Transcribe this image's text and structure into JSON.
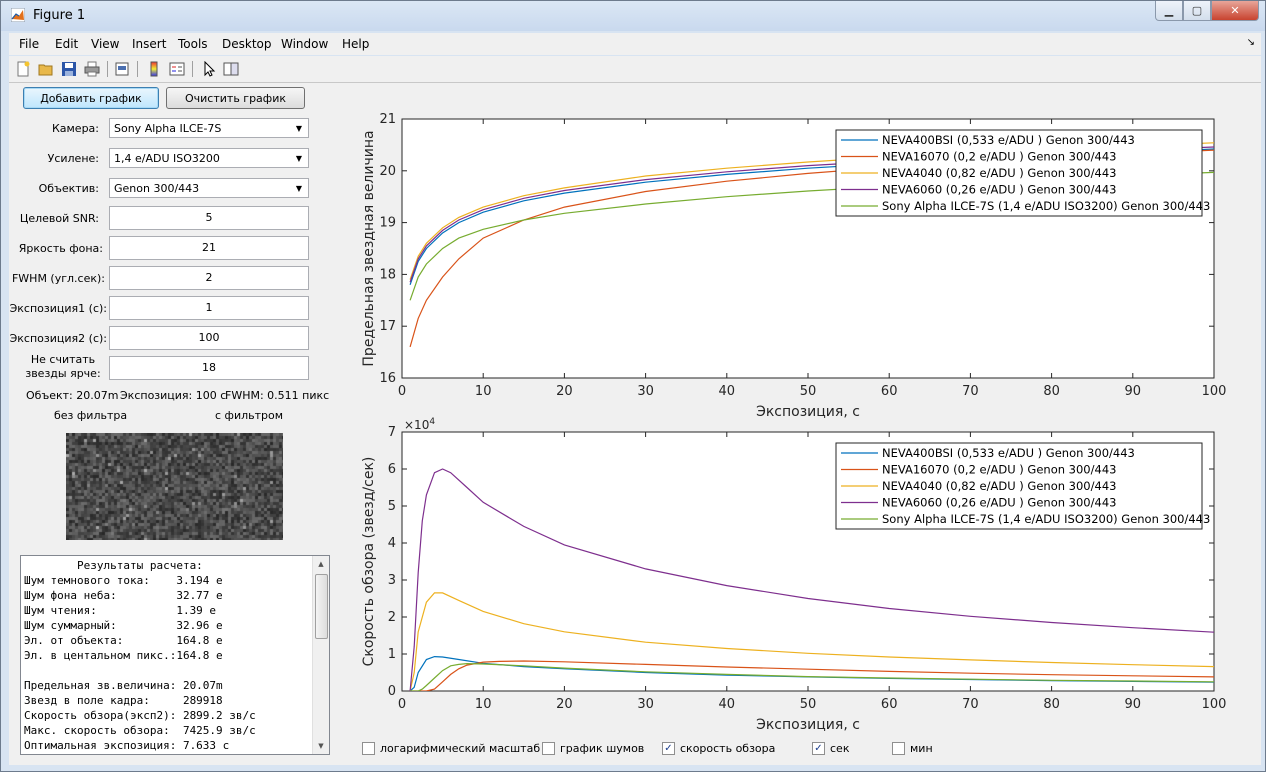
{
  "window": {
    "title": "Figure 1"
  },
  "menu": [
    "File",
    "Edit",
    "View",
    "Insert",
    "Tools",
    "Desktop",
    "Window",
    "Help"
  ],
  "toolbar_icons": [
    "new-figure-icon",
    "open-file-icon",
    "save-icon",
    "print-icon",
    "print-preview-icon",
    "colorbar-icon",
    "legend-icon",
    "pointer-icon",
    "property-editor-icon"
  ],
  "buttons": {
    "add": "Добавить график",
    "clear": "Очистить график"
  },
  "fields": {
    "camera": {
      "label": "Камера:",
      "value": "Sony Alpha ILCE-7S"
    },
    "gain": {
      "label": "Усилене:",
      "value": "1,4 e/ADU ISO3200"
    },
    "lens": {
      "label": "Объектив:",
      "value": "Genon 300/443"
    },
    "snr": {
      "label": "Целевой SNR:",
      "value": "5"
    },
    "sky": {
      "label": "Яркость фона:",
      "value": "21"
    },
    "fwhm": {
      "label": "FWHM (угл.сек):",
      "value": "2"
    },
    "exp1": {
      "label": "Экспозиция1 (с):",
      "value": "1"
    },
    "exp2": {
      "label": "Экспозиция2 (с):",
      "value": "100"
    },
    "ignore": {
      "label1": "Не считать",
      "label2": "звезды ярче:",
      "value": "18"
    }
  },
  "info": {
    "object": "Объект: 20.07m",
    "exposure": "Экспозиция: 100 с",
    "fwhm": "FWHM: 0.511 пикс"
  },
  "preview": {
    "no_filter": "без фильтра",
    "with_filter": "с фильтром"
  },
  "results_text": "        Результаты расчета:\nШум темнового тока:    3.194 e\nШум фона неба:         32.77 e\nШум чтения:            1.39 e\nШум суммарный:         32.96 e\nЭл. от объекта:        164.8 e\nЭл. в центальном пикс.:164.8 e\n\nПредельная зв.величина: 20.07m\nЗвезд в поле кадра:     289918\nСкорость обзора(эксп2): 2899.2 зв/с\nМакс. скорость обзора:  7425.9 зв/с\nОптимальная экспозиция: 7.633 с",
  "checkboxes": [
    {
      "label": "логарифмический масштаб",
      "checked": false
    },
    {
      "label": "график шумов",
      "checked": false
    },
    {
      "label": "скорость обзора",
      "checked": true
    },
    {
      "label": "сек",
      "checked": true
    },
    {
      "label": "мин",
      "checked": false
    }
  ],
  "colors": {
    "s1": "#0072bd",
    "s2": "#d95319",
    "s3": "#edb120",
    "s4": "#7e2f8e",
    "s5": "#77ac30"
  },
  "chart_data": [
    {
      "type": "line",
      "xlabel": "Экспозиция, с",
      "ylabel": "Предельная звездная величина",
      "xlim": [
        0,
        100
      ],
      "ylim": [
        16,
        21
      ],
      "xticks": [
        0,
        10,
        20,
        30,
        40,
        50,
        60,
        70,
        80,
        90,
        100
      ],
      "yticks": [
        16,
        17,
        18,
        19,
        20,
        21
      ],
      "legend_position": "top-right",
      "series": [
        {
          "name": "NEVA400BSI (0,533 e/ADU )  Genon 300/443",
          "x": [
            1,
            2,
            3,
            5,
            7,
            10,
            15,
            20,
            30,
            40,
            50,
            60,
            70,
            80,
            90,
            100
          ],
          "y": [
            17.8,
            18.25,
            18.5,
            18.8,
            19.0,
            19.2,
            19.42,
            19.57,
            19.78,
            19.93,
            20.05,
            20.14,
            20.22,
            20.29,
            20.35,
            20.42
          ]
        },
        {
          "name": "NEVA16070 (0,2 e/ADU )  Genon 300/443",
          "x": [
            1,
            2,
            3,
            5,
            7,
            10,
            15,
            20,
            30,
            40,
            50,
            60,
            70,
            80,
            90,
            100
          ],
          "y": [
            16.6,
            17.15,
            17.5,
            17.95,
            18.3,
            18.7,
            19.05,
            19.3,
            19.6,
            19.8,
            19.95,
            20.07,
            20.17,
            20.26,
            20.33,
            20.4
          ]
        },
        {
          "name": "NEVA4040 (0,82 e/ADU )  Genon 300/443",
          "x": [
            1,
            2,
            3,
            5,
            7,
            10,
            15,
            20,
            30,
            40,
            50,
            60,
            70,
            80,
            90,
            100
          ],
          "y": [
            17.9,
            18.35,
            18.6,
            18.9,
            19.1,
            19.3,
            19.52,
            19.67,
            19.9,
            20.05,
            20.17,
            20.27,
            20.35,
            20.42,
            20.48,
            20.54
          ]
        },
        {
          "name": "NEVA6060 (0,26 e/ADU )  Genon 300/443",
          "x": [
            1,
            2,
            3,
            5,
            7,
            10,
            15,
            20,
            30,
            40,
            50,
            60,
            70,
            80,
            90,
            100
          ],
          "y": [
            17.85,
            18.3,
            18.55,
            18.85,
            19.05,
            19.25,
            19.47,
            19.62,
            19.83,
            19.98,
            20.1,
            20.19,
            20.27,
            20.34,
            20.4,
            20.46
          ]
        },
        {
          "name": "Sony Alpha ILCE-7S (1,4 e/ADU ISO3200)  Genon 300/443",
          "x": [
            1,
            2,
            3,
            5,
            7,
            10,
            15,
            20,
            30,
            40,
            50,
            60,
            70,
            80,
            90,
            100
          ],
          "y": [
            17.5,
            17.95,
            18.2,
            18.5,
            18.7,
            18.87,
            19.05,
            19.18,
            19.36,
            19.5,
            19.61,
            19.7,
            19.78,
            19.85,
            19.91,
            19.97
          ]
        }
      ]
    },
    {
      "type": "line",
      "xlabel": "Экспозиция, с",
      "ylabel": "Скорость обзора (звезд/сек)",
      "y_multiplier": "×10^4",
      "xlim": [
        0,
        100
      ],
      "ylim": [
        0,
        7
      ],
      "xticks": [
        0,
        10,
        20,
        30,
        40,
        50,
        60,
        70,
        80,
        90,
        100
      ],
      "yticks": [
        0,
        1,
        2,
        3,
        4,
        5,
        6,
        7
      ],
      "legend_position": "top-right",
      "series": [
        {
          "name": "NEVA400BSI (0,533 e/ADU )  Genon 300/443",
          "x": [
            1,
            1.5,
            2,
            3,
            4,
            5,
            7,
            10,
            15,
            20,
            30,
            40,
            50,
            60,
            70,
            80,
            90,
            100
          ],
          "y": [
            0,
            0.1,
            0.5,
            0.85,
            0.93,
            0.92,
            0.85,
            0.75,
            0.66,
            0.6,
            0.5,
            0.43,
            0.38,
            0.34,
            0.31,
            0.28,
            0.26,
            0.24
          ]
        },
        {
          "name": "NEVA16070 (0,2 e/ADU )  Genon 300/443",
          "x": [
            1,
            3,
            4,
            5,
            6,
            7,
            8,
            10,
            12,
            15,
            20,
            30,
            40,
            50,
            60,
            70,
            80,
            90,
            100
          ],
          "y": [
            0,
            0,
            0.05,
            0.25,
            0.45,
            0.6,
            0.7,
            0.78,
            0.8,
            0.81,
            0.79,
            0.72,
            0.65,
            0.59,
            0.53,
            0.48,
            0.44,
            0.41,
            0.38
          ]
        },
        {
          "name": "NEVA4040 (0,82 e/ADU )  Genon 300/443",
          "x": [
            1,
            1.5,
            2,
            3,
            4,
            5,
            7,
            10,
            15,
            20,
            30,
            40,
            50,
            60,
            70,
            80,
            90,
            100
          ],
          "y": [
            0,
            0.5,
            1.6,
            2.4,
            2.65,
            2.65,
            2.45,
            2.15,
            1.82,
            1.6,
            1.32,
            1.15,
            1.02,
            0.92,
            0.84,
            0.77,
            0.71,
            0.66
          ]
        },
        {
          "name": "NEVA6060 (0,26 e/ADU )  Genon 300/443",
          "x": [
            1,
            1.5,
            2,
            2.5,
            3,
            4,
            5,
            6,
            8,
            10,
            15,
            20,
            30,
            40,
            50,
            60,
            70,
            80,
            90,
            100
          ],
          "y": [
            0,
            1.2,
            3.2,
            4.6,
            5.3,
            5.9,
            6.0,
            5.9,
            5.5,
            5.1,
            4.45,
            3.95,
            3.3,
            2.85,
            2.5,
            2.23,
            2.02,
            1.85,
            1.71,
            1.59
          ]
        },
        {
          "name": "Sony Alpha ILCE-7S (1,4 e/ADU ISO3200)  Genon 300/443",
          "x": [
            1,
            2,
            2.5,
            3,
            4,
            5,
            6,
            7,
            8,
            10,
            15,
            20,
            30,
            40,
            50,
            60,
            70,
            80,
            90,
            100
          ],
          "y": [
            0,
            0,
            0.05,
            0.15,
            0.35,
            0.55,
            0.68,
            0.72,
            0.74,
            0.73,
            0.68,
            0.62,
            0.52,
            0.45,
            0.39,
            0.35,
            0.32,
            0.29,
            0.27,
            0.25
          ]
        }
      ]
    }
  ]
}
